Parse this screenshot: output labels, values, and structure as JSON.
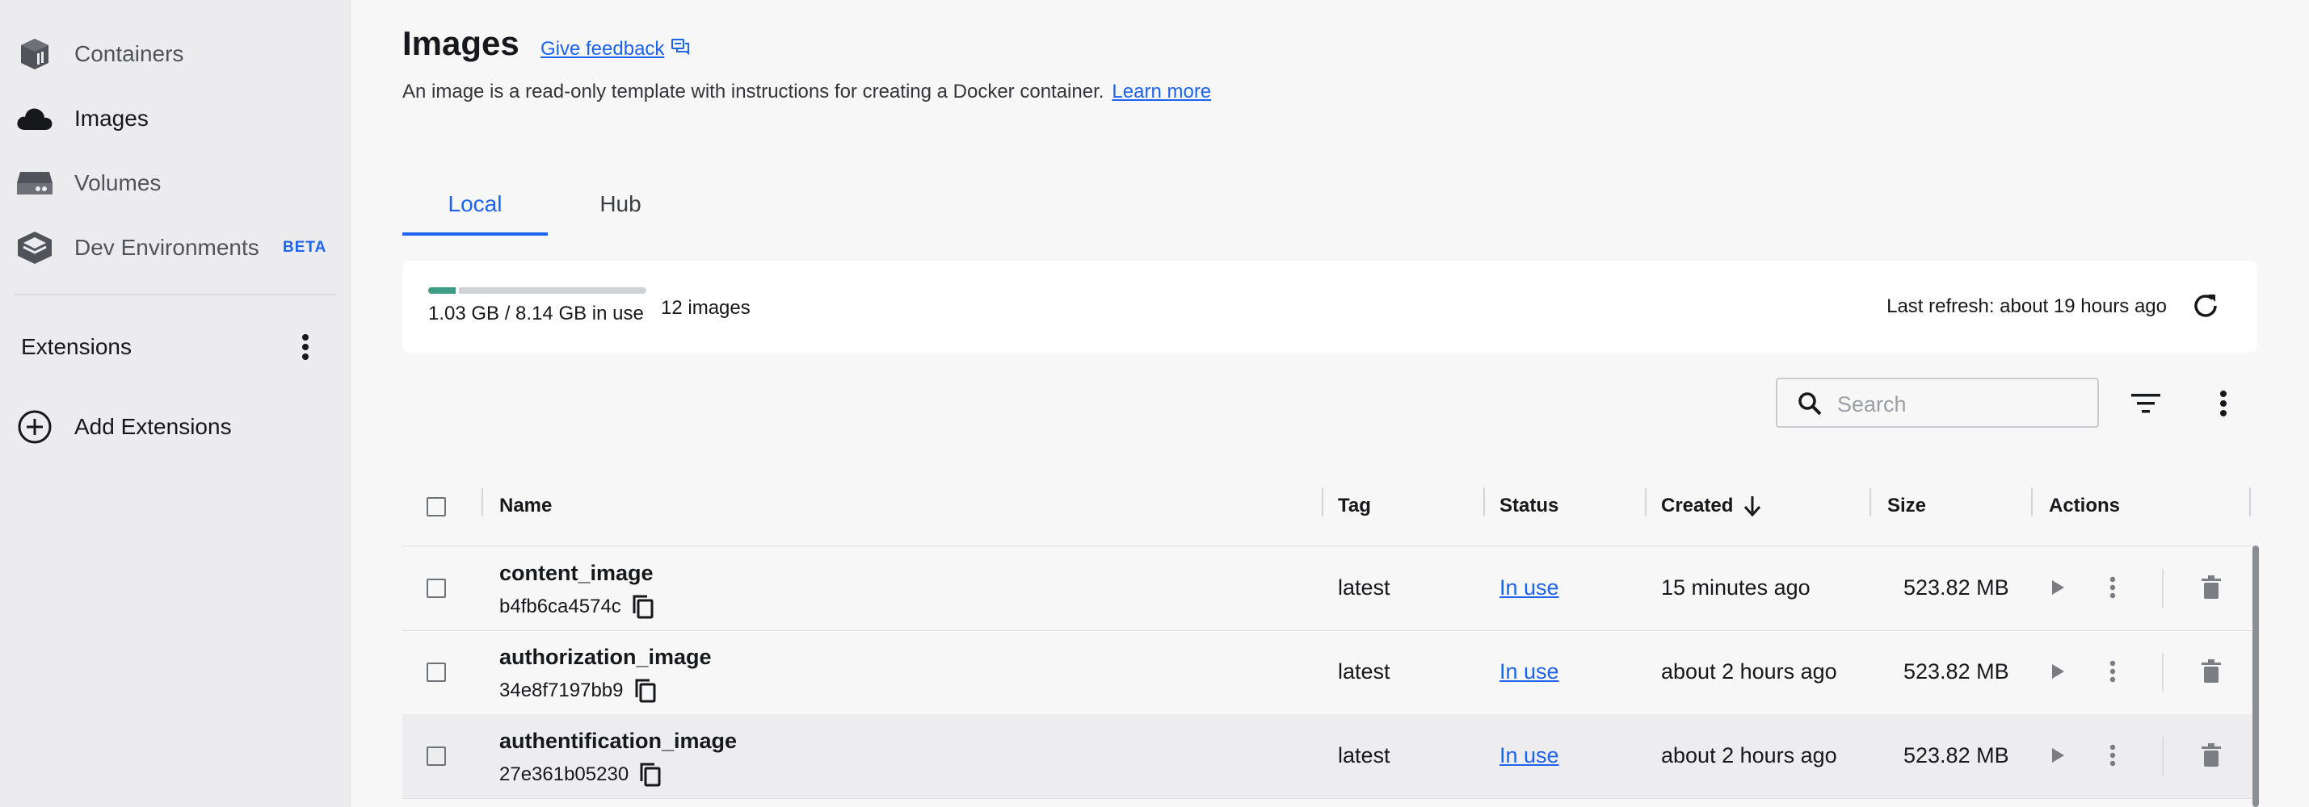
{
  "sidebar": {
    "items": [
      {
        "label": "Containers",
        "icon": "containers-icon"
      },
      {
        "label": "Images",
        "icon": "cloud-icon",
        "active": true
      },
      {
        "label": "Volumes",
        "icon": "volume-icon"
      },
      {
        "label": "Dev Environments",
        "icon": "dev-environments-icon",
        "badge": "BETA"
      }
    ],
    "extensions_label": "Extensions",
    "add_extensions_label": "Add Extensions"
  },
  "header": {
    "title": "Images",
    "feedback_label": "Give feedback",
    "description": "An image is a read-only template with instructions for creating a Docker container.",
    "learn_more": "Learn more"
  },
  "tabs": [
    {
      "label": "Local",
      "active": true
    },
    {
      "label": "Hub",
      "active": false
    }
  ],
  "usage": {
    "text": "1.03 GB / 8.14 GB in use",
    "used_fraction": 0.127,
    "count": "12 images",
    "last_refresh": "Last refresh: about 19 hours ago"
  },
  "toolbar": {
    "search_placeholder": "Search"
  },
  "table": {
    "columns": {
      "name": "Name",
      "tag": "Tag",
      "status": "Status",
      "created": "Created",
      "size": "Size",
      "actions": "Actions"
    },
    "rows": [
      {
        "name": "content_image",
        "id": "b4fb6ca4574c",
        "tag": "latest",
        "status": "In use",
        "created": "15 minutes ago",
        "size": "523.82 MB"
      },
      {
        "name": "authorization_image",
        "id": "34e8f7197bb9",
        "tag": "latest",
        "status": "In use",
        "created": "about 2 hours ago",
        "size": "523.82 MB"
      },
      {
        "name": "authentification_image",
        "id": "27e361b05230",
        "tag": "latest",
        "status": "In use",
        "created": "about 2 hours ago",
        "size": "523.82 MB"
      }
    ]
  },
  "colors": {
    "accent": "#1d63ed",
    "usage_fill": "#3e9c82",
    "sidebar_bg": "#ececee"
  }
}
